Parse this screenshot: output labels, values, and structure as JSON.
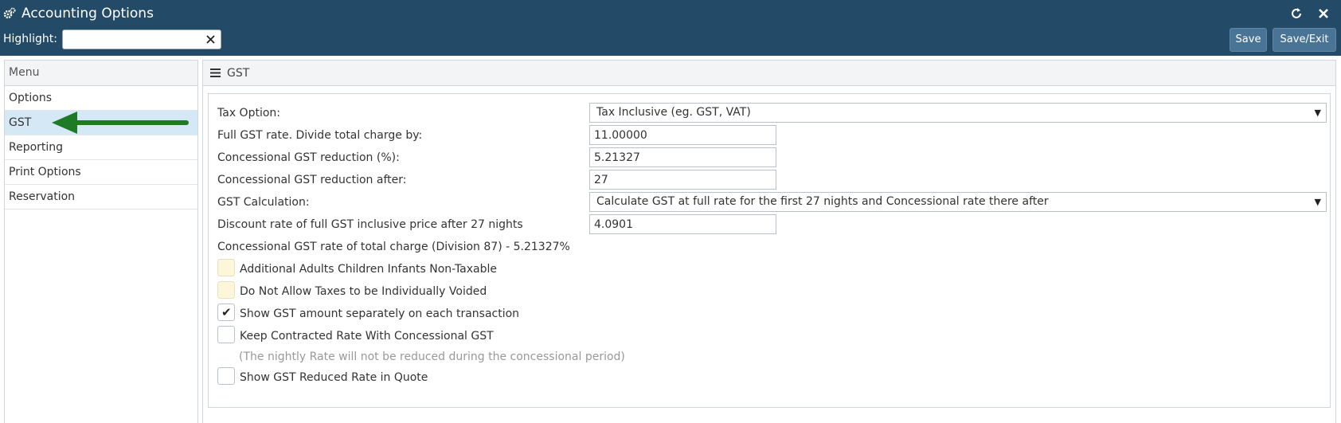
{
  "window": {
    "title": "Accounting Options",
    "title_icon": "gears-icon",
    "refresh_icon": "refresh-icon",
    "close_icon": "close-icon"
  },
  "highlight": {
    "label": "Highlight:",
    "value": "",
    "clear_icon": "x-icon"
  },
  "toolbar": {
    "save_label": "Save",
    "save_exit_label": "Save/Exit"
  },
  "menu": {
    "heading": "Menu",
    "items": [
      {
        "label": "Options",
        "active": false
      },
      {
        "label": "GST",
        "active": true
      },
      {
        "label": "Reporting",
        "active": false
      },
      {
        "label": "Print Options",
        "active": false
      },
      {
        "label": "Reservation",
        "active": false
      }
    ],
    "arrow_color": "#1e7a25"
  },
  "content": {
    "title": "GST",
    "tax_option": {
      "label": "Tax Option:",
      "value": "Tax Inclusive (eg. GST, VAT)"
    },
    "full_gst_rate": {
      "label": "Full GST rate. Divide total charge by:",
      "value": "11.00000"
    },
    "concessional_reduction": {
      "label": "Concessional GST reduction (%):",
      "value": "5.21327"
    },
    "concessional_after": {
      "label": "Concessional GST reduction after:",
      "value": "27"
    },
    "gst_calculation": {
      "label": "GST Calculation:",
      "value": "Calculate GST at full rate for the first 27 nights and Concessional rate there after"
    },
    "discount_rate": {
      "label": "Discount rate of full GST inclusive price after 27 nights",
      "value": "4.0901"
    },
    "concessional_rate_text": "Concessional GST rate of total charge (Division 87) - 5.21327%",
    "checkboxes": [
      {
        "label": "Additional Adults Children Infants Non-Taxable",
        "checked": false
      },
      {
        "label": "Do Not Allow Taxes to be Individually Voided",
        "checked": false
      },
      {
        "label": "Show GST amount separately on each transaction",
        "checked": true
      },
      {
        "label": "Keep Contracted Rate With Concessional GST",
        "checked": false
      },
      {
        "label": "Show GST Reduced Rate in Quote",
        "checked": false
      }
    ],
    "note": "(The nightly Rate will not be reduced during the concessional period)"
  },
  "colors": {
    "header_bg": "#234a66",
    "button_bg": "#4a7495",
    "active_menu_bg": "#d5e8f6"
  }
}
